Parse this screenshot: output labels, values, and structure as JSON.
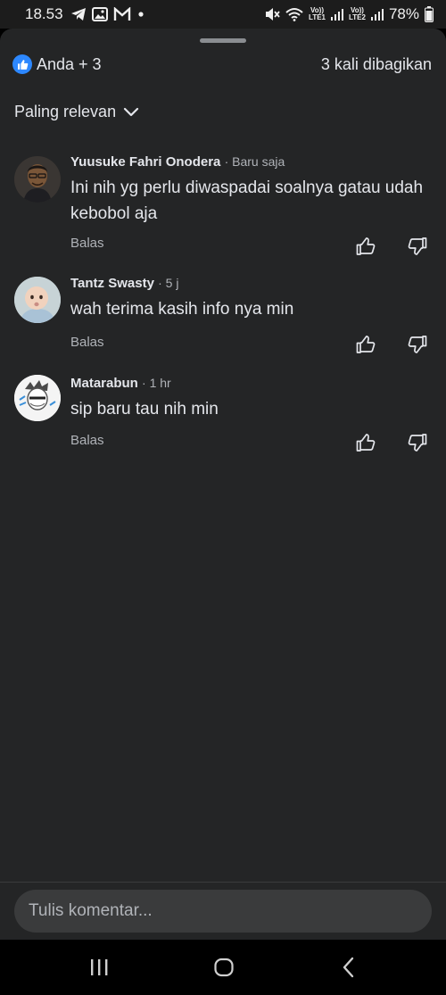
{
  "status": {
    "time": "18.53",
    "battery": "78%",
    "sim1_label": "LTE1",
    "sim2_label": "LTE2",
    "volte_label": "Vo))"
  },
  "reactions": {
    "summary": "Anda + 3",
    "shares": "3 kali dibagikan",
    "accent": "#2d88ff"
  },
  "sort": {
    "label": "Paling relevan"
  },
  "comments": [
    {
      "author": "Yuusuke Fahri Onodera",
      "time": "· Baru saja",
      "text": "Ini nih yg perlu diwaspadai soalnya gatau udah kebobol aja",
      "reply": "Balas"
    },
    {
      "author": "Tantz Swasty",
      "time": "· 5 j",
      "text": "wah terima kasih info nya min",
      "reply": "Balas"
    },
    {
      "author": "Matarabun",
      "time": "· 1 hr",
      "text": "sip baru tau nih min",
      "reply": "Balas"
    }
  ],
  "composer": {
    "placeholder": "Tulis komentar..."
  },
  "icons": {
    "status_left": [
      "telegram-icon",
      "gallery-icon",
      "gmail-icon",
      "notification-dot-icon"
    ],
    "status_right": [
      "mute-icon",
      "wifi-icon",
      "signal-icon",
      "battery-icon"
    ],
    "actions": [
      "thumbs-up-icon",
      "thumbs-down-icon"
    ],
    "nav": [
      "recents-icon",
      "home-icon",
      "back-icon"
    ]
  }
}
